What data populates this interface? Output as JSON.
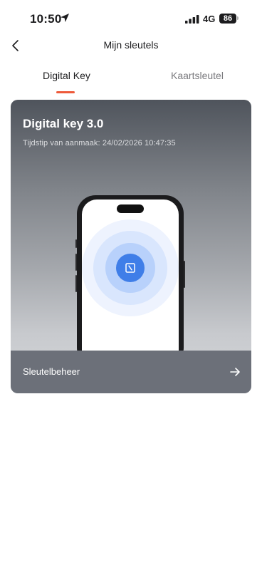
{
  "status_bar": {
    "time": "10:50",
    "network": "4G",
    "battery": "86",
    "icons": [
      "location-arrow-icon",
      "signal-icon"
    ]
  },
  "header": {
    "title": "Mijn sleutels",
    "back_icon": "chevron-left-icon"
  },
  "tabs": [
    {
      "label": "Digital Key",
      "active": true
    },
    {
      "label": "Kaartsleutel",
      "active": false
    }
  ],
  "card": {
    "title": "Digital key 3.0",
    "subtitle": "Tijdstip van aanmaak: 24/02/2026 10:47:35",
    "illustration_icon": "nfc-key-icon",
    "action": {
      "label": "Sleutelbeheer",
      "icon": "arrow-right-icon"
    }
  },
  "colors": {
    "tab_indicator": "#ee5a3a",
    "key_blue": "#3f7ee8",
    "card_dark": "#4f545c"
  }
}
